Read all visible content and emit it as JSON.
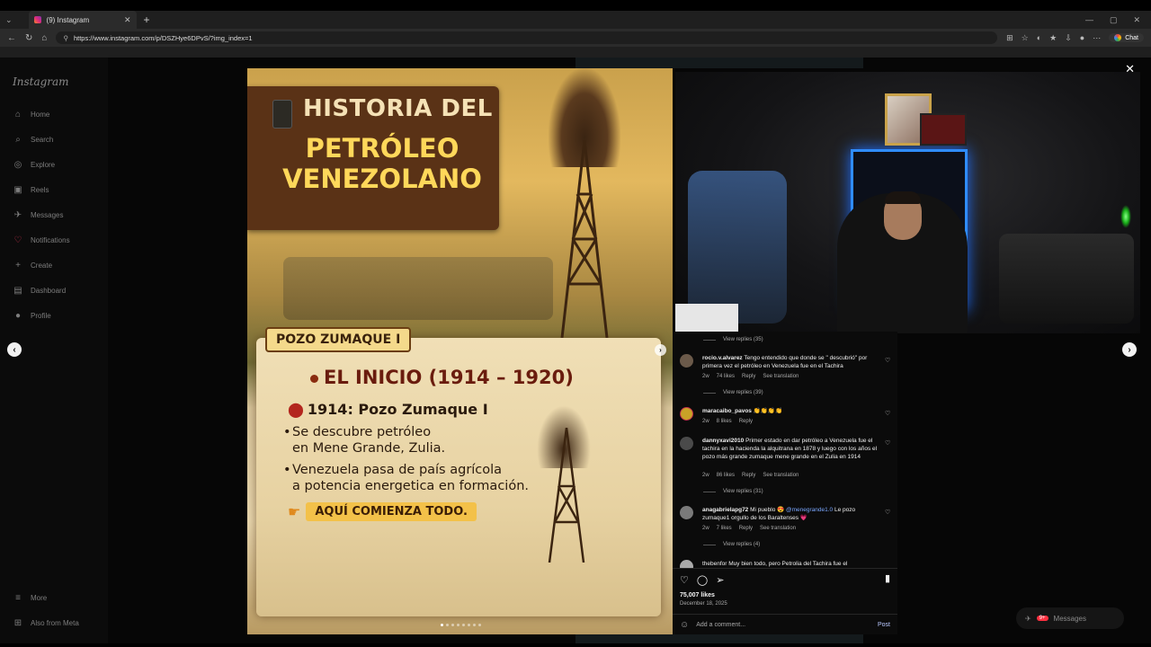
{
  "browser": {
    "tab_title": "(9) Instagram",
    "url": "https://www.instagram.com/p/DSZHye6DPvS/?img_index=1",
    "chat_label": "Chat"
  },
  "sidebar": {
    "logo": "Instagram",
    "items": [
      {
        "label": "Home",
        "icon": "⌂"
      },
      {
        "label": "Search",
        "icon": "⌕"
      },
      {
        "label": "Explore",
        "icon": "◎"
      },
      {
        "label": "Reels",
        "icon": "▣"
      },
      {
        "label": "Messages",
        "icon": "✈"
      },
      {
        "label": "Notifications",
        "icon": "♡"
      },
      {
        "label": "Create",
        "icon": "+"
      },
      {
        "label": "Dashboard",
        "icon": "▤"
      },
      {
        "label": "Profile",
        "icon": "●"
      }
    ],
    "bottom": [
      {
        "label": "More",
        "icon": "≡"
      },
      {
        "label": "Also from Meta",
        "icon": "⊞"
      }
    ]
  },
  "post_image": {
    "title_top": "HISTORIA DEL",
    "title_main_1": "PETRÓLEO",
    "title_main_2": "VENEZOLANO",
    "tag": "POZO ZUMAQUE I",
    "heading": "EL INICIO (1914 – 1920)",
    "year_line": "1914: Pozo Zumaque I",
    "bullet1_a": "Se descubre petróleo",
    "bullet1_b": "en Mene Grande, Zulia.",
    "bullet2_a": "Venezuela pasa de país agrícola",
    "bullet2_b": "a potencia energetica en formación.",
    "cta": "AQUÍ COMIENZA TODO."
  },
  "comments": {
    "view_replies": [
      "View replies (35)",
      "View replies (39)",
      "View replies (31)",
      "View replies (4)"
    ],
    "items": [
      {
        "user": "rocio.v.alvarez",
        "text": "Tengo entendido que donde se \" descubrió\" por primera vez el petróleo en Venezuela fue en el Tachira",
        "age": "2w",
        "likes": "74 likes",
        "reply": "Reply",
        "translate": "See translation"
      },
      {
        "user": "maracaibo_pavos",
        "text": "👏👏👏👏",
        "age": "2w",
        "likes": "8 likes",
        "reply": "Reply",
        "translate": ""
      },
      {
        "user": "dannyxavi2010",
        "text": "Primer estado en dar petróleo a Venezuela fue el tachira en la hacienda la alquitrana en 1878 y luego con los años el pozo más grande zumaque mene grande en el Zulia en 1914",
        "age": "2w",
        "likes": "86 likes",
        "reply": "Reply",
        "translate": "See translation"
      },
      {
        "user": "anagabrielapg72",
        "text_pre": "Mi pueblo 😍 ",
        "mention": "@menegrande1.0",
        "text_post": " Le pozo zumaque1 orgullo de los Baraltenses 💗",
        "age": "2w",
        "likes": "7 likes",
        "reply": "Reply",
        "translate": "See translation"
      }
    ],
    "partial": "thebenfor Muy bien todo, pero Petrolia del Tachira fue el"
  },
  "actions": {
    "likes": "75,007 likes",
    "date": "December 18, 2025",
    "add_comment_placeholder": "Add a comment...",
    "post_label": "Post"
  },
  "messages_pill": {
    "label": "Messages",
    "badge": "9+"
  },
  "colors": {
    "accent": "#0095f6",
    "background": "#060606",
    "mention": "#7aa7ff"
  }
}
